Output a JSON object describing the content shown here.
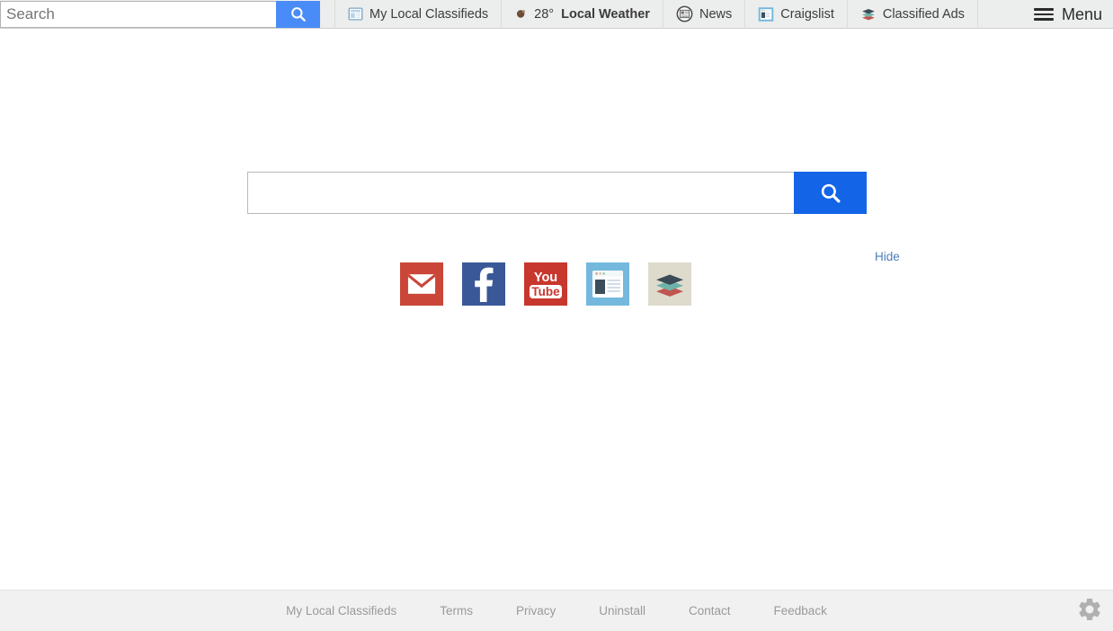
{
  "toolbar": {
    "search_placeholder": "Search",
    "search_value": "",
    "search_button_icon": "search-icon",
    "items": [
      {
        "label": "My Local Classifieds",
        "icon": "classifieds-window-icon"
      },
      {
        "label": "Local Weather",
        "icon": "weather-icon",
        "temperature": "28°"
      },
      {
        "label": "News",
        "icon": "news-circle-icon"
      },
      {
        "label": "Craigslist",
        "icon": "craigslist-window-icon"
      },
      {
        "label": "Classified Ads",
        "icon": "layers-stack-icon"
      }
    ],
    "menu_label": "Menu",
    "menu_icon": "hamburger-icon"
  },
  "main": {
    "search_placeholder": "",
    "search_value": "",
    "search_button_icon": "search-icon",
    "hide_label": "Hide",
    "tiles": [
      {
        "name": "gmail",
        "icon": "envelope-icon",
        "color": "#ca4638"
      },
      {
        "name": "facebook",
        "icon": "facebook-f-icon",
        "color": "#3a5897"
      },
      {
        "name": "youtube",
        "icon": "youtube-icon",
        "color": "#c8372d",
        "line1": "You",
        "line2": "Tube"
      },
      {
        "name": "browser",
        "icon": "browser-window-icon",
        "color": "#74b9dd"
      },
      {
        "name": "layers",
        "icon": "layers-stack-icon",
        "color": "#dedbcd"
      }
    ]
  },
  "footer": {
    "links": [
      "My Local Classifieds",
      "Terms",
      "Privacy",
      "Uninstall",
      "Contact",
      "Feedback"
    ],
    "settings_icon": "gear-icon"
  },
  "colors": {
    "toolbar_bg": "#eceded",
    "toolbar_button_blue": "#4a8cf7",
    "main_button_blue": "#1464e8",
    "footer_bg": "#f1f1f1",
    "link_blue": "#4a7ebb",
    "footer_text": "#9a9a9a"
  }
}
